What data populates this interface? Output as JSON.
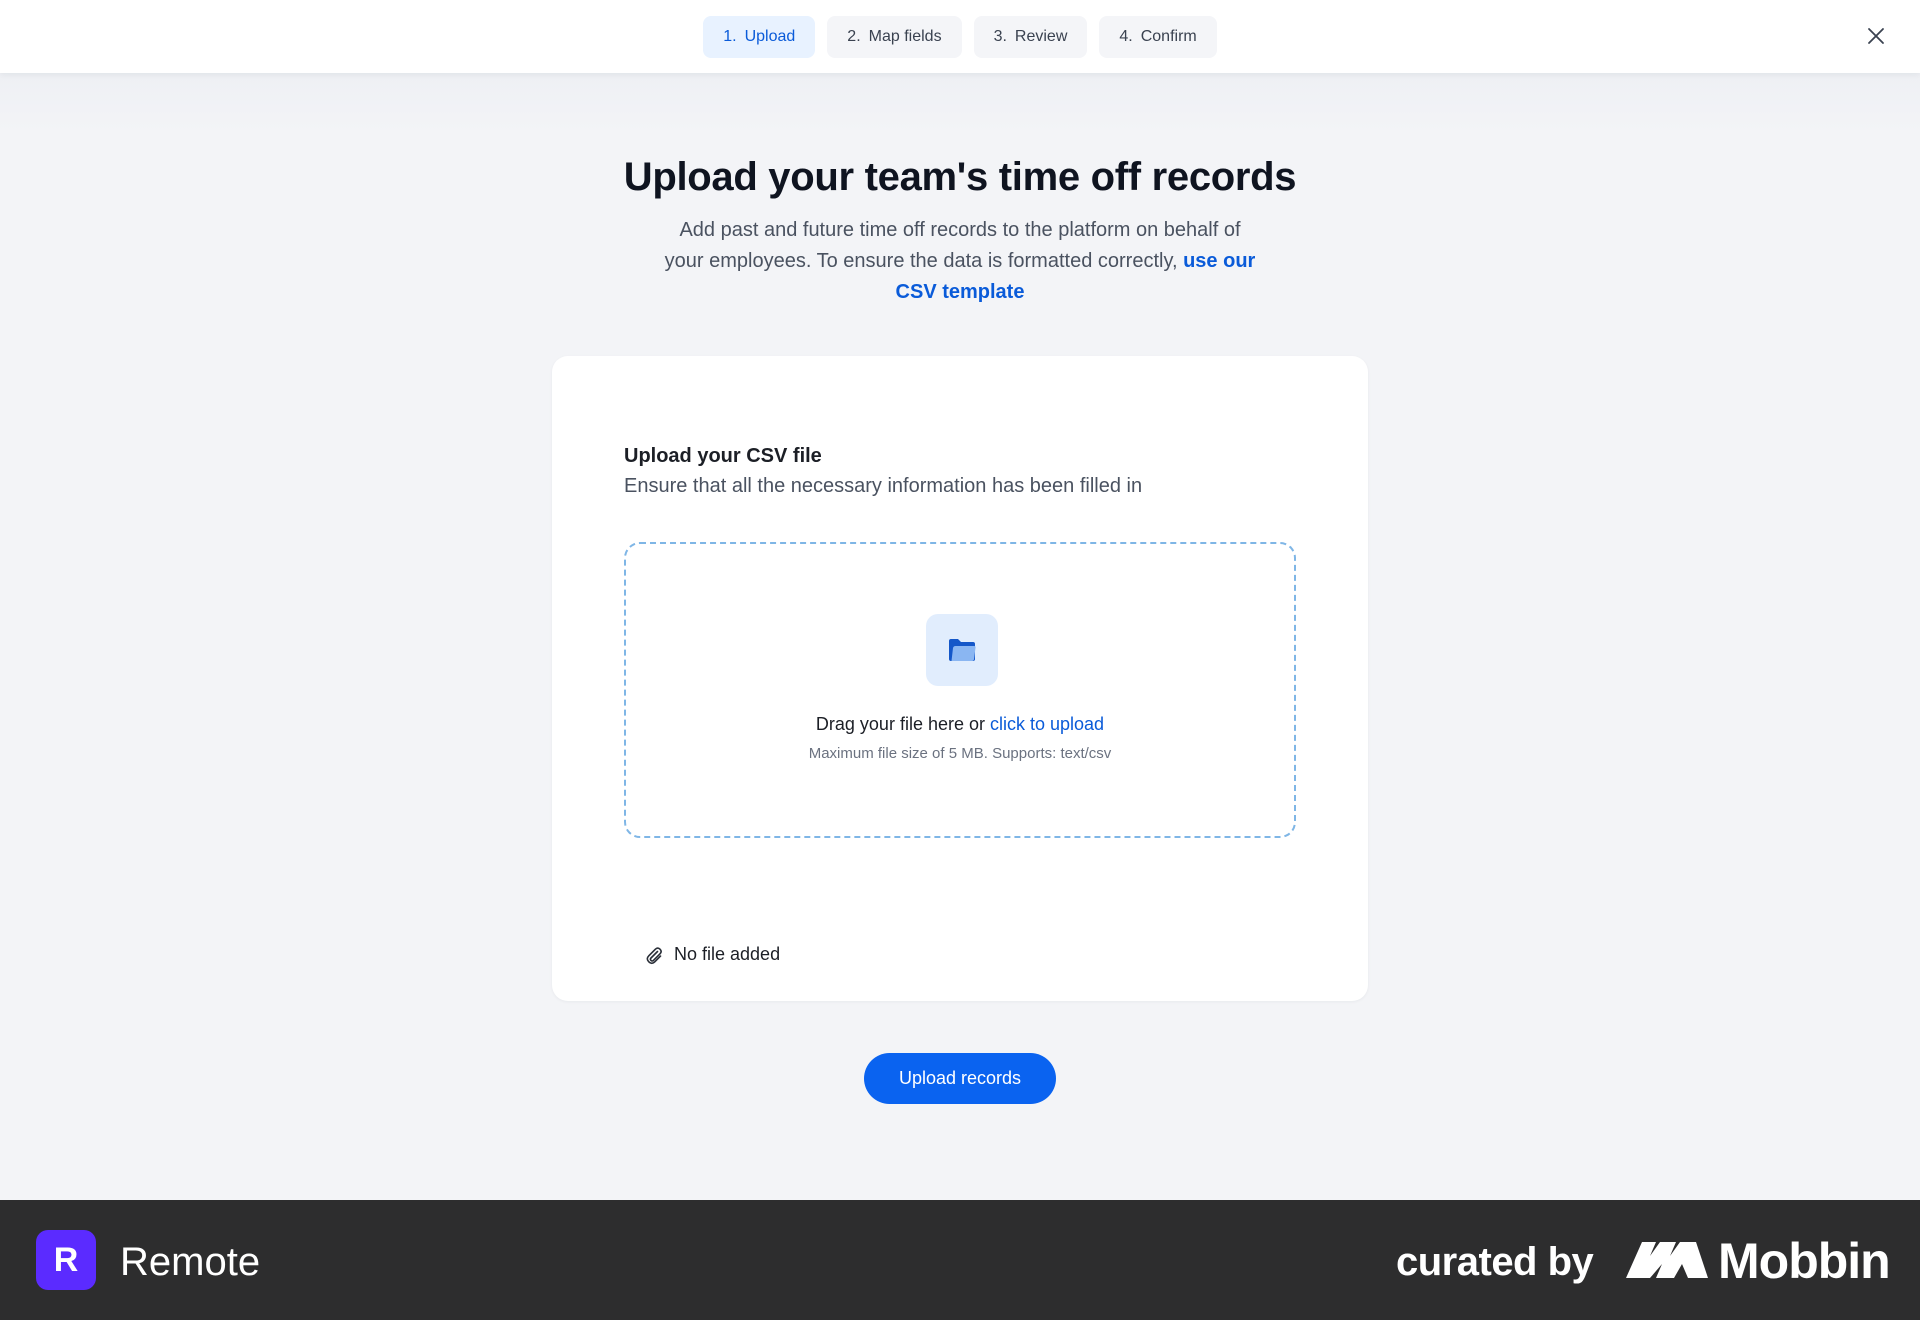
{
  "stepper": {
    "steps": [
      {
        "number": "1.",
        "label": "Upload",
        "active": true
      },
      {
        "number": "2.",
        "label": "Map fields",
        "active": false
      },
      {
        "number": "3.",
        "label": "Review",
        "active": false
      },
      {
        "number": "4.",
        "label": "Confirm",
        "active": false
      }
    ],
    "close_icon": "close-icon"
  },
  "page": {
    "title": "Upload your team's time off records",
    "subtitle_text": "Add past and future time off records to the platform on behalf of your employees. To ensure the data is formatted correctly,",
    "subtitle_link": "use our CSV template"
  },
  "upload_card": {
    "title": "Upload your CSV file",
    "description": "Ensure that all the necessary information has been filled in",
    "dropzone": {
      "icon": "folder-icon",
      "text": "Drag your file here or",
      "link": "click to upload",
      "hint": "Maximum file size of 5 MB. Supports: text/csv"
    },
    "file_status": {
      "icon": "paperclip-icon",
      "text": "No file added"
    }
  },
  "actions": {
    "upload_button": "Upload records"
  },
  "footer": {
    "brand_initial": "R",
    "brand_name": "Remote",
    "curated_by": "curated by",
    "mobbin": "Mobbin"
  },
  "colors": {
    "accent": "#0a63f0",
    "link": "#0a5bd9",
    "active_step_bg": "#e8f2ff",
    "brand_purple": "#5b2bff",
    "footer_bg": "#2d2d2e"
  }
}
